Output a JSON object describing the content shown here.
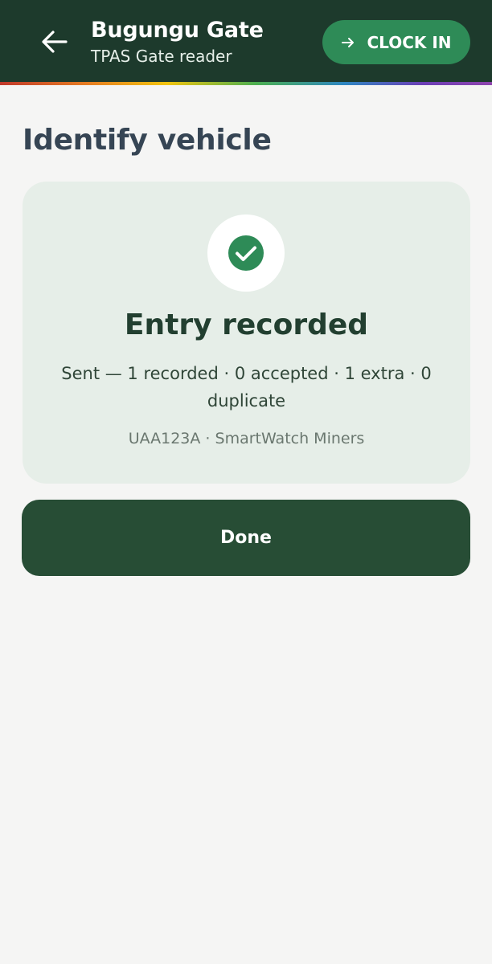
{
  "header": {
    "title": "Bugungu Gate",
    "subtitle": "TPAS Gate reader",
    "back_icon": "arrow-left-icon",
    "clock_in": {
      "label": "CLOCK IN",
      "icon": "arrow-right-icon"
    }
  },
  "main": {
    "title": "Identify vehicle",
    "result": {
      "icon": "check-circle-icon",
      "title": "Entry recorded",
      "summary": "Sent — 1 recorded · 0 accepted · 1 extra · 0 duplicate",
      "detail": "UAA123A · SmartWatch Miners"
    },
    "done_label": "Done"
  },
  "colors": {
    "header_bg": "#1d3a2c",
    "accent_green": "#2e8b57",
    "card_bg": "#e6eee8",
    "primary_button": "#274d35",
    "page_bg": "#f5f5f4",
    "title_text": "#364554"
  }
}
